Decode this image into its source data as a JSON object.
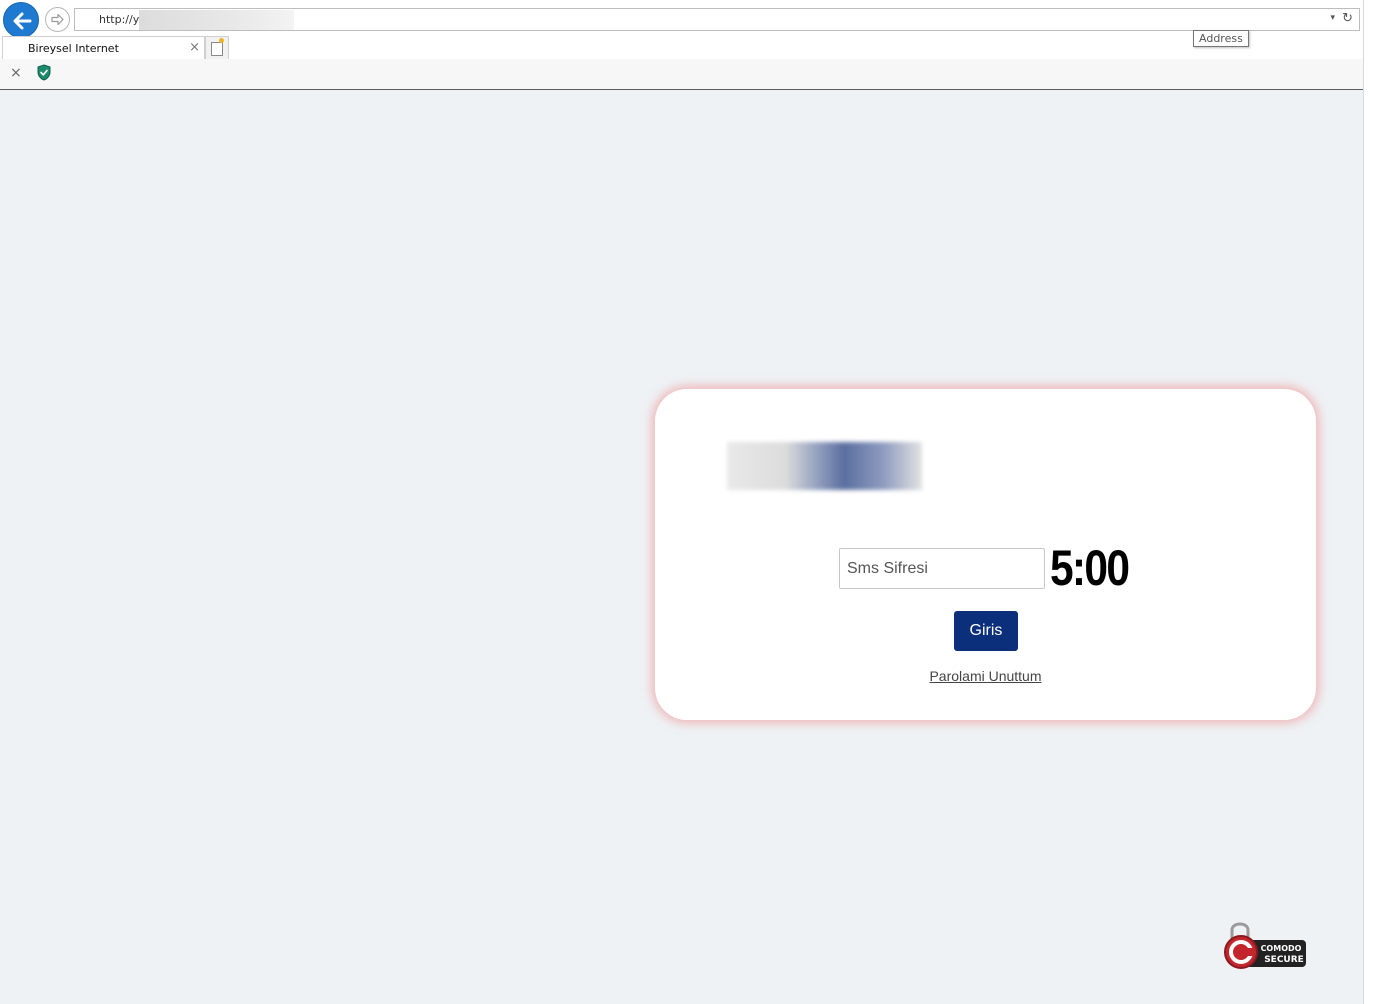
{
  "browser": {
    "url_text": "http://y",
    "address_tooltip": "Address",
    "tab_title": "Bireysel Internet",
    "tab_close_glyph": "×",
    "toolbar_close_glyph": "×",
    "refresh_glyph": "↻",
    "dropdown_glyph": "▾",
    "icons": [
      "back-arrow-icon",
      "forward-arrow-icon",
      "refresh-icon",
      "new-tab-icon",
      "shield-icon"
    ],
    "accent_color": "#1e7ad0"
  },
  "login": {
    "sms_placeholder": "Sms Sifresi",
    "timer": "5:00",
    "submit_label": "Giris",
    "forgot_link": "Parolami Unuttum",
    "button_color": "#0b2f7a"
  },
  "badge": {
    "brand_line1": "COMODO",
    "brand_line2": "SECURE"
  }
}
